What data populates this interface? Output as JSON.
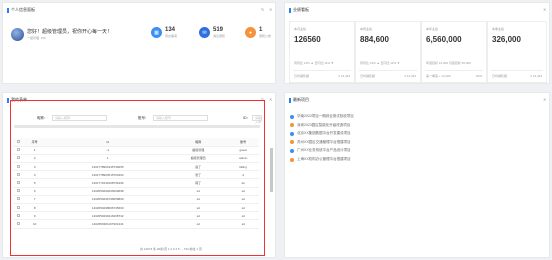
{
  "profile": {
    "title": "个人信息面板",
    "greeting": "您好！超级管理员，祝你开心每一天！",
    "role": "一级管理: 150",
    "stats": [
      {
        "value": "134",
        "label": "待办事项",
        "color": "#3b8ff5",
        "icon": "calendar-icon"
      },
      {
        "value": "519",
        "label": "消息通知",
        "color": "#2f6fe0",
        "icon": "message-icon"
      },
      {
        "value": "1",
        "label": "通知公告",
        "color": "#f5923b",
        "icon": "bell-icon"
      }
    ],
    "controls": [
      "↻",
      "✕"
    ]
  },
  "performance": {
    "title": "业绩看板",
    "close": "✕",
    "cards": [
      {
        "label": "本月业绩",
        "value": "126560",
        "compare": "周同比 12% ▲  日同比 11% ▼",
        "foot_label": "日均销售额",
        "foot_value": "¥ 12,423"
      },
      {
        "label": "本周业绩",
        "value": "884,600",
        "compare": "周同比 12% ▲  日同比 11% ▼",
        "foot_label": "日均销售额",
        "foot_value": "¥ 12,423"
      },
      {
        "label": "本年业绩",
        "value": "6,560,000",
        "compare": "年度目标 12,000 月度目标 50,000",
        "foot_label": "第一季度 + 12,000",
        "foot_value": "60%"
      },
      {
        "label": "本季业绩",
        "value": "326,000",
        "compare": "",
        "foot_label": "日均销售额",
        "foot_value": "¥ 12,423"
      }
    ]
  },
  "grid_panel": {
    "title": "我的表单",
    "controls": [
      "↻",
      "✕"
    ],
    "filters": [
      {
        "label": "昵称：",
        "placeholder": "请输入昵称"
      },
      {
        "label": "账号：",
        "placeholder": "请输入账号"
      },
      {
        "label": "ID：",
        "placeholder": "请输入ID"
      }
    ],
    "columns": [
      "序号",
      "id",
      "昵称",
      "账号"
    ],
    "rows": [
      [
        "1",
        "-1",
        "超级管理",
        "guest"
      ],
      [
        "2",
        "1",
        "超级管理员",
        "admin"
      ],
      [
        "3",
        "1401778961945739265",
        "赵丁",
        "likling"
      ],
      [
        "4",
        "1401778963515703494",
        "张丁",
        "d"
      ],
      [
        "5",
        "1401779139168736196",
        "韩丁",
        "ds"
      ],
      [
        "6",
        "1402659292005269698",
        "sd",
        "sd"
      ],
      [
        "7",
        "1402659296796659890",
        "sd",
        "sd"
      ],
      [
        "8",
        "1402659298606745600",
        "sd",
        "sd"
      ],
      [
        "9",
        "1402659299416268732",
        "sd",
        "sd"
      ],
      [
        "10",
        "1402659301167901344",
        "sd",
        "sd"
      ]
    ],
    "pagination": "共 14673 条   20条/页   1  2  3  4  5 ... 734   前往   1  页"
  },
  "todo_panel": {
    "title": "最新项目",
    "close": "✕",
    "items": [
      {
        "text": "华南2022项目一期综合测试验收项目",
        "color": "#3b8ff5"
      },
      {
        "text": "深圳2023园区智能化升级改造项目",
        "color": "#f5923b"
      },
      {
        "text": "北京XX集团数据中台开发建设项目",
        "color": "#3b8ff5"
      },
      {
        "text": "苏州XX园区交通管理平台搭建项目",
        "color": "#f5923b"
      },
      {
        "text": "广州XX业务系统平台产品设计项目",
        "color": "#3b8ff5"
      },
      {
        "text": "上海XX机构办公管理平台搭建项目",
        "color": "#f5923b"
      }
    ]
  }
}
